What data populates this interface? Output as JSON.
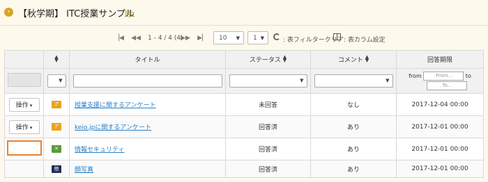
{
  "header": {
    "title": "【秋学期】 ITC授業サンプル",
    "badge": "月1",
    "icon": "chevron-right-circle-icon",
    "accent": "#d8a521"
  },
  "pager": {
    "info": "1 - 4 / 4 (4)",
    "page_size": "10",
    "page": "1",
    "filter_clear": ": 表フィルタークリア",
    "column_settings": ": 表カラム設定"
  },
  "table": {
    "headers": [
      "",
      "",
      "タイトル",
      "ステータス",
      "コメント",
      "回答期限"
    ],
    "filter": {
      "from_label": "from",
      "from_placeholder": "From...",
      "to_label": "to",
      "to_placeholder": "To..."
    },
    "rows": [
      {
        "action": "操作",
        "tag": "ア",
        "title": "授業支援に関するアンケート",
        "status": "未回答",
        "comment": "なし",
        "deadline": "2017-12-04 00:00"
      },
      {
        "action": "操作",
        "tag": "ア",
        "title": "keio.jpに関するアンケート",
        "status": "回答済",
        "comment": "あり",
        "deadline": "2017-12-01 00:00"
      },
      {
        "action": "",
        "tag": "✕",
        "title": "情報セキュリティ",
        "status": "回答済",
        "comment": "あり",
        "deadline": "2017-12-01 00:00"
      },
      {
        "action": "",
        "tag": "他",
        "title": "顔写真",
        "status": "回答済",
        "comment": "あり",
        "deadline": "2017-12-01 00:00"
      }
    ]
  }
}
